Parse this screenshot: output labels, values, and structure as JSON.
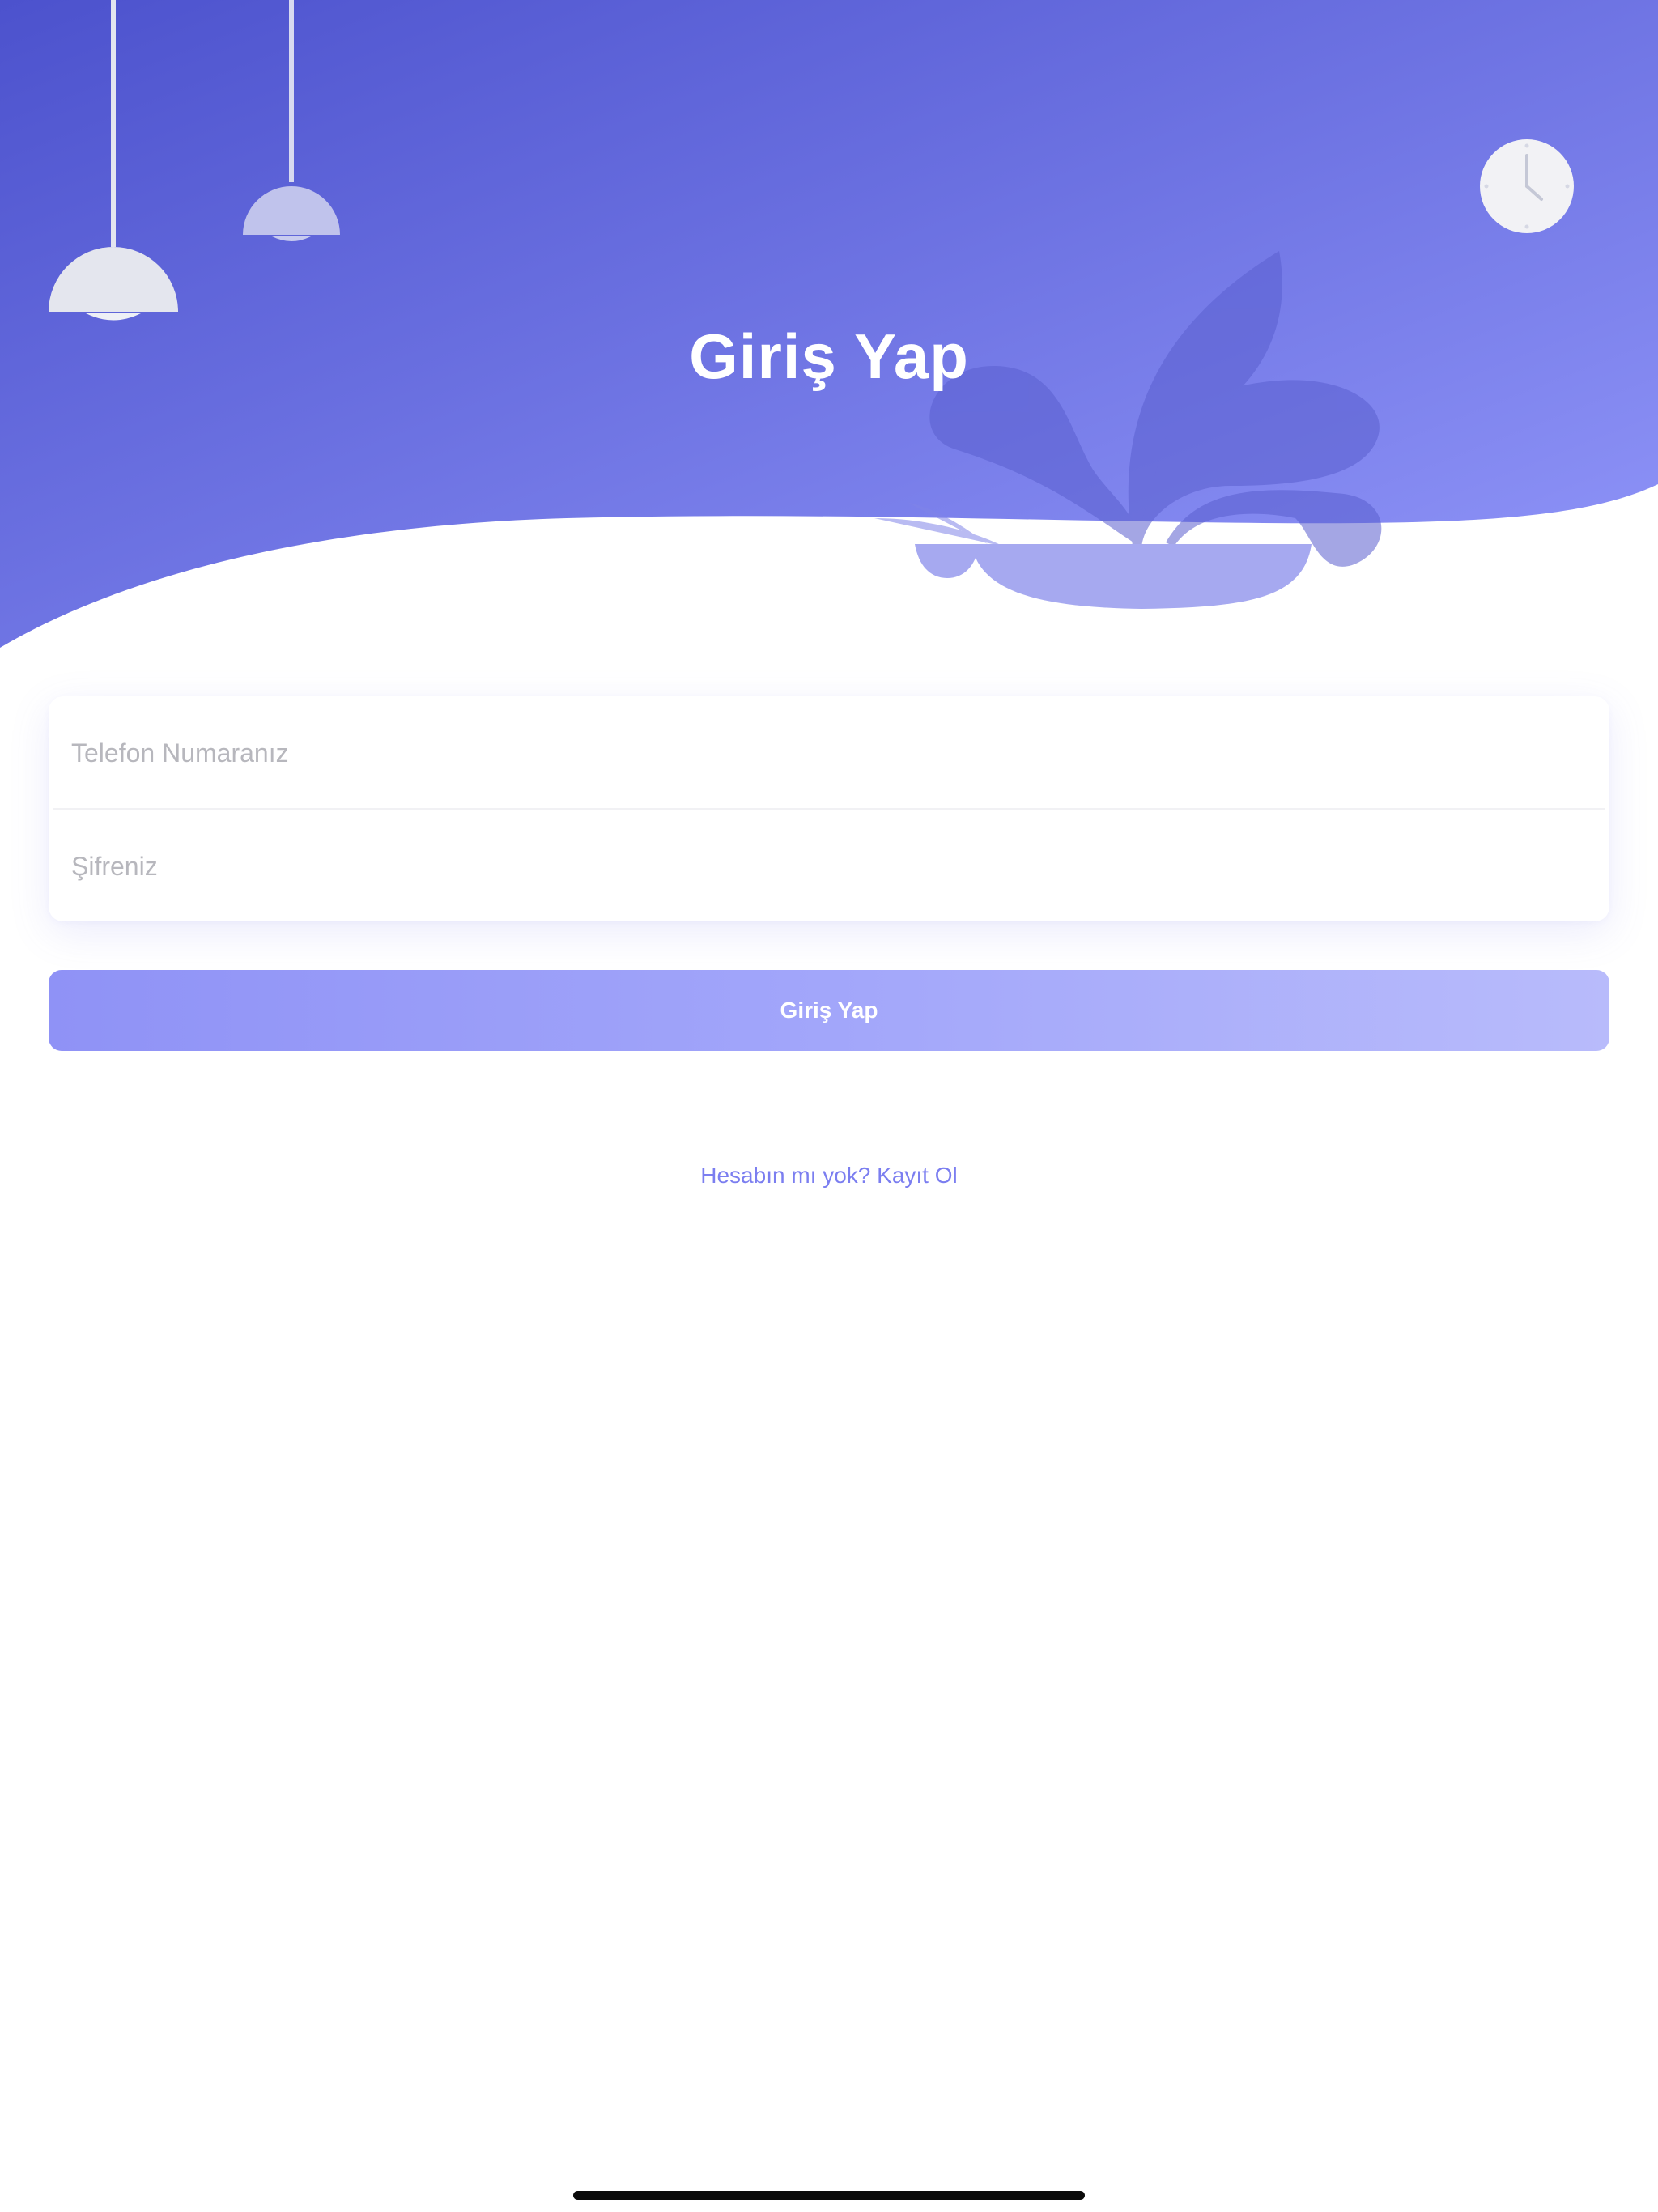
{
  "header": {
    "title": "Giriş Yap",
    "gradient_start": "#4f55cf",
    "gradient_end": "#8f94f8"
  },
  "form": {
    "phone_placeholder": "Telefon Numaranız",
    "phone_value": "",
    "password_placeholder": "Şifreniz",
    "password_value": ""
  },
  "actions": {
    "login_label": "Giriş Yap",
    "register_link": "Hesabın mı yok? Kayıt Ol"
  },
  "decorations": {
    "icons": [
      "pendant-lamp-icon",
      "pendant-lamp-icon",
      "wall-clock-icon",
      "potted-plant-icon"
    ]
  },
  "colors": {
    "accent": "#8f92f6",
    "link": "#7b7ef0"
  }
}
